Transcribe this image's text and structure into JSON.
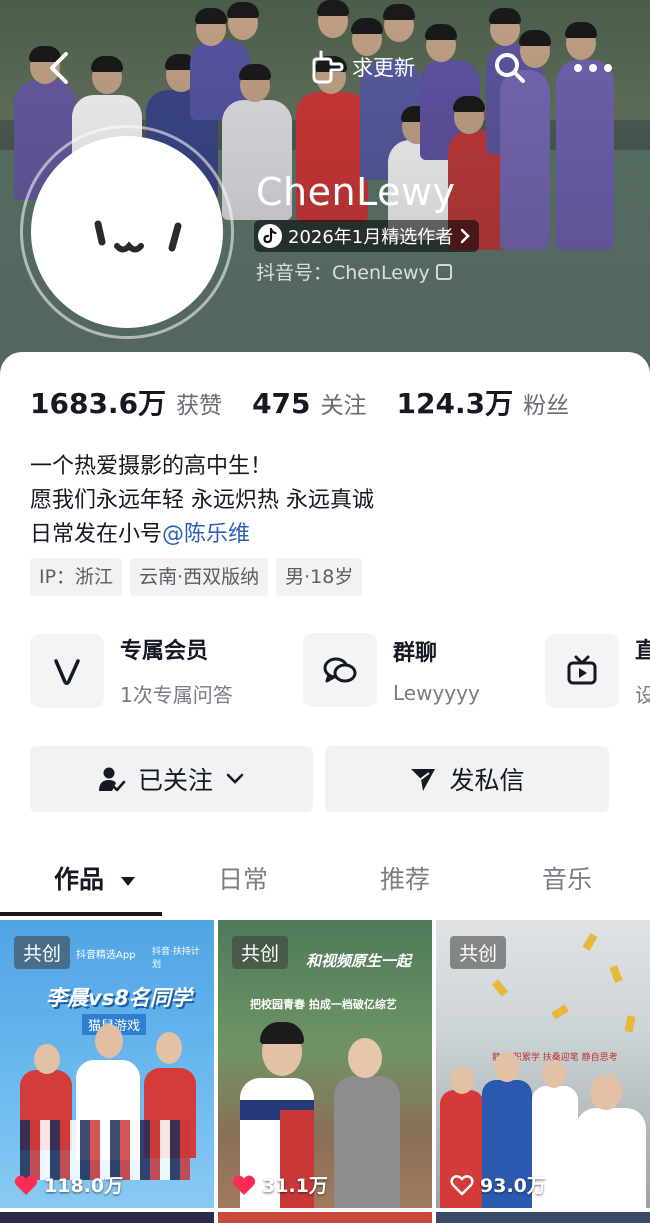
{
  "header": {
    "update_label": "求更新",
    "nickname": "ChenLewy",
    "badge_label": "2026年1月精选作者",
    "douyin_id": "抖音号：ChenLewy"
  },
  "stats": [
    {
      "value": "1683.6万",
      "label": "获赞"
    },
    {
      "value": "475",
      "label": "关注"
    },
    {
      "value": "124.3万",
      "label": "粉丝"
    }
  ],
  "bio": {
    "line1": "一个热爱摄影的高中生！",
    "line2": "愿我们永远年轻 永远炽热 永远真诚",
    "line3_prefix": "日常发在小号",
    "line3_mention": "@陈乐维"
  },
  "tags": [
    "IP：浙江",
    "云南·西双版纳",
    "男·18岁"
  ],
  "features": [
    {
      "title": "专属会员",
      "subtitle": "1次专属问答",
      "icon": "v-member-icon"
    },
    {
      "title": "群聊",
      "subtitle": "Lewyyyy",
      "icon": "chat-bubbles-icon"
    },
    {
      "title": "直",
      "subtitle": "设",
      "icon": "tv-live-icon"
    }
  ],
  "actions": {
    "following_label": "已关注",
    "message_label": "发私信"
  },
  "tabs": [
    "作品",
    "日常",
    "推荐",
    "音乐"
  ],
  "videos": [
    {
      "badge": "共创",
      "likes": "118.0万"
    },
    {
      "badge": "共创",
      "likes": "31.1万"
    },
    {
      "badge": "共创",
      "likes": "93.0万"
    }
  ],
  "thumb_text": {
    "t1_top_left": "抖音精选App",
    "t1_top_right": "抖音·扶持计划",
    "t1_title": "李晨vs8名同学",
    "t1_subtitle": "猫鼠游戏",
    "t2_title": "和视频原生一起",
    "t2_sub": "把校园青春 拍成一档破亿综艺",
    "t3_banner": "静 先积累学 扶桑迎笔 静自思考"
  },
  "colors": {
    "link": "#2b5eb5",
    "like_red": "#fe2c55",
    "text": "#161823"
  }
}
